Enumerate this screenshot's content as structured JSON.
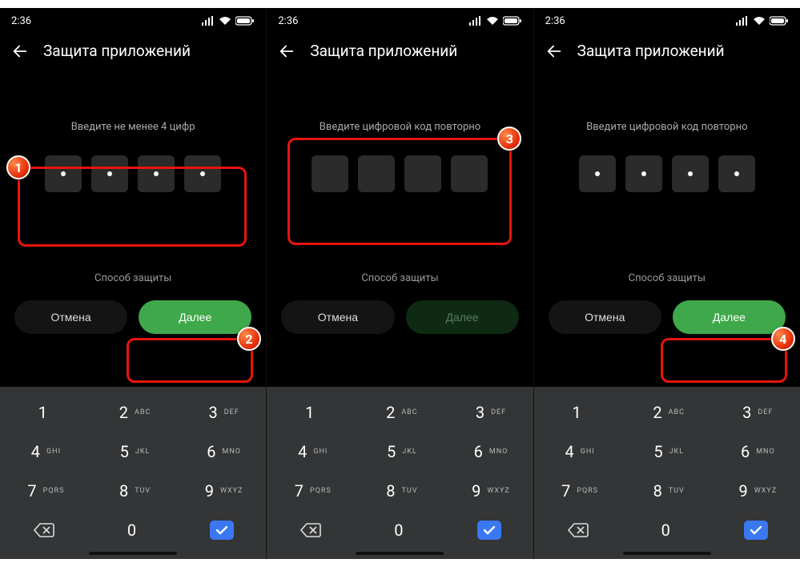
{
  "status": {
    "time": "2:36"
  },
  "header": {
    "title": "Защита приложений"
  },
  "screens": [
    {
      "prompt": "Введите не менее 4 цифр",
      "filled": true,
      "method_label": "Способ защиты",
      "cancel": "Отмена",
      "next": "Далее",
      "next_enabled": true
    },
    {
      "prompt": "Введите цифровой код повторно",
      "filled": false,
      "method_label": "Способ защиты",
      "cancel": "Отмена",
      "next": "Далее",
      "next_enabled": false
    },
    {
      "prompt": "Введите цифровой код повторно",
      "filled": true,
      "method_label": "Способ защиты",
      "cancel": "Отмена",
      "next": "Далее",
      "next_enabled": true
    }
  ],
  "keypad": {
    "keys": [
      {
        "d": "1",
        "s": ""
      },
      {
        "d": "2",
        "s": "ABC"
      },
      {
        "d": "3",
        "s": "DEF"
      },
      {
        "d": "4",
        "s": "GHI"
      },
      {
        "d": "5",
        "s": "JKL"
      },
      {
        "d": "6",
        "s": "MNO"
      },
      {
        "d": "7",
        "s": "PQRS"
      },
      {
        "d": "8",
        "s": "TUV"
      },
      {
        "d": "9",
        "s": "WXYZ"
      }
    ],
    "zero": "0"
  },
  "badges": [
    "1",
    "2",
    "3",
    "4"
  ]
}
